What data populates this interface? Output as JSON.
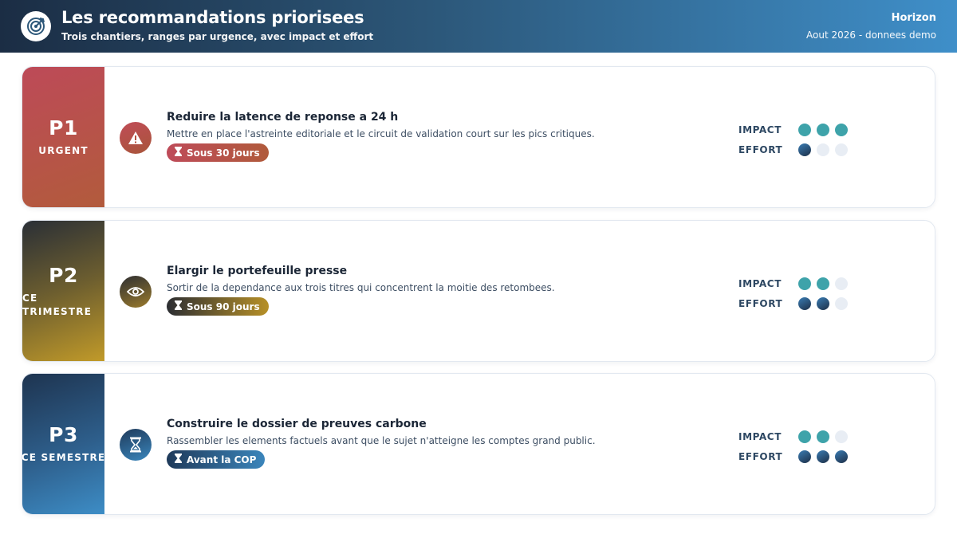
{
  "header": {
    "title": "Les recommandations priorisees",
    "subtitle": "Trois chantiers, ranges par urgence, avec impact et effort",
    "brand": "Horizon",
    "date": "Aout 2026 - donnees demo",
    "logo_icon": "target-icon"
  },
  "labels": {
    "impact": "IMPACT",
    "effort": "EFFORT"
  },
  "recommendations": [
    {
      "code": "P1",
      "priority": "URGENT",
      "icon": "warning-icon",
      "title": "Reduire la latence de reponse a 24 h",
      "description": "Mettre en place l'astreinte editoriale et le circuit de validation court sur les pics critiques.",
      "deadline": "Sous 30 jours",
      "impact": 3,
      "effort": 1,
      "max": 3
    },
    {
      "code": "P2",
      "priority": "CE TRIMESTRE",
      "icon": "eye-icon",
      "title": "Elargir le portefeuille presse",
      "description": "Sortir de la dependance aux trois titres qui concentrent la moitie des retombees.",
      "deadline": "Sous 90 jours",
      "impact": 2,
      "effort": 2,
      "max": 3
    },
    {
      "code": "P3",
      "priority": "CE SEMESTRE",
      "icon": "hourglass-icon",
      "title": "Construire le dossier de preuves carbone",
      "description": "Rassembler les elements factuels avant que le sujet n'atteigne les comptes grand public.",
      "deadline": "Avant la COP",
      "impact": 2,
      "effort": 3,
      "max": 3
    }
  ],
  "colors": {
    "impact_dot": "#3ea3aa",
    "empty_dot": "#e8edf4"
  }
}
